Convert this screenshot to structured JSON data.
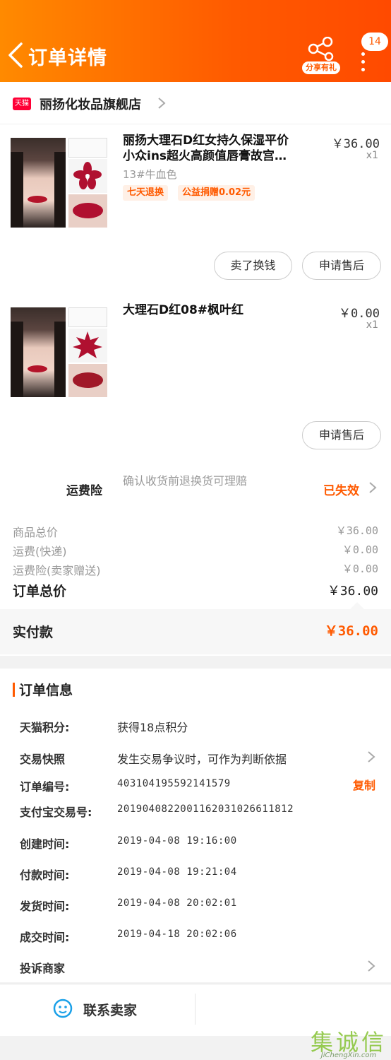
{
  "header": {
    "title": "订单详情",
    "share_label": "分享有礼",
    "badge_count": "14"
  },
  "store": {
    "badge": "天猫",
    "name": "丽扬化妆品旗舰店"
  },
  "products": [
    {
      "title_line1": "丽扬大理石D红女持久保湿平价",
      "title_line2": "小众ins超火高颜值唇膏故宫…",
      "price": "￥36.00",
      "qty": "x1",
      "sku": "13#牛血色",
      "tags": [
        "七天退换",
        "公益捐赠0.02元"
      ],
      "buttons": [
        "卖了换钱",
        "申请售后"
      ]
    },
    {
      "title_line1": "大理石D红08#枫叶红",
      "price": "￥0.00",
      "qty": "x1",
      "buttons": [
        "申请售后"
      ]
    }
  ],
  "insurance": {
    "label": "运费险",
    "desc": "确认收货前退换货可理赔",
    "status": "已失效"
  },
  "summary": {
    "rows": [
      {
        "label": "商品总价",
        "value": "￥36.00"
      },
      {
        "label": "运费(快递)",
        "value": "￥0.00"
      },
      {
        "label": "运费险(卖家赠送)",
        "value": "￥0.00"
      }
    ],
    "total_label": "订单总价",
    "total_value": "￥36.00",
    "paid_label": "实付款",
    "paid_value": "￥36.00"
  },
  "order_info": {
    "title": "订单信息",
    "points_label": "天猫积分:",
    "points_value": "获得18点积分",
    "snapshot_label": "交易快照",
    "snapshot_value": "发生交易争议时，可作为判断依据",
    "order_no_label": "订单编号:",
    "order_no_value": "403104195592141579",
    "copy_label": "复制",
    "alipay_label": "支付宝交易号:",
    "alipay_value": "2019040822001162031026611812",
    "created_label": "创建时间:",
    "created_value": "2019-04-08 19:16:00",
    "paid_label": "付款时间:",
    "paid_value": "2019-04-08 19:21:04",
    "shipped_label": "发货时间:",
    "shipped_value": "2019-04-08 20:02:01",
    "done_label": "成交时间:",
    "done_value": "2019-04-18 20:02:06",
    "complain_label": "投诉商家"
  },
  "bottom": {
    "contact_label": "联系卖家"
  },
  "watermark": {
    "big": "集诚信",
    "small": "JiChengXin.com"
  },
  "colors": {
    "accent": "#ff5a00",
    "tmall_red": "#ff0036"
  }
}
